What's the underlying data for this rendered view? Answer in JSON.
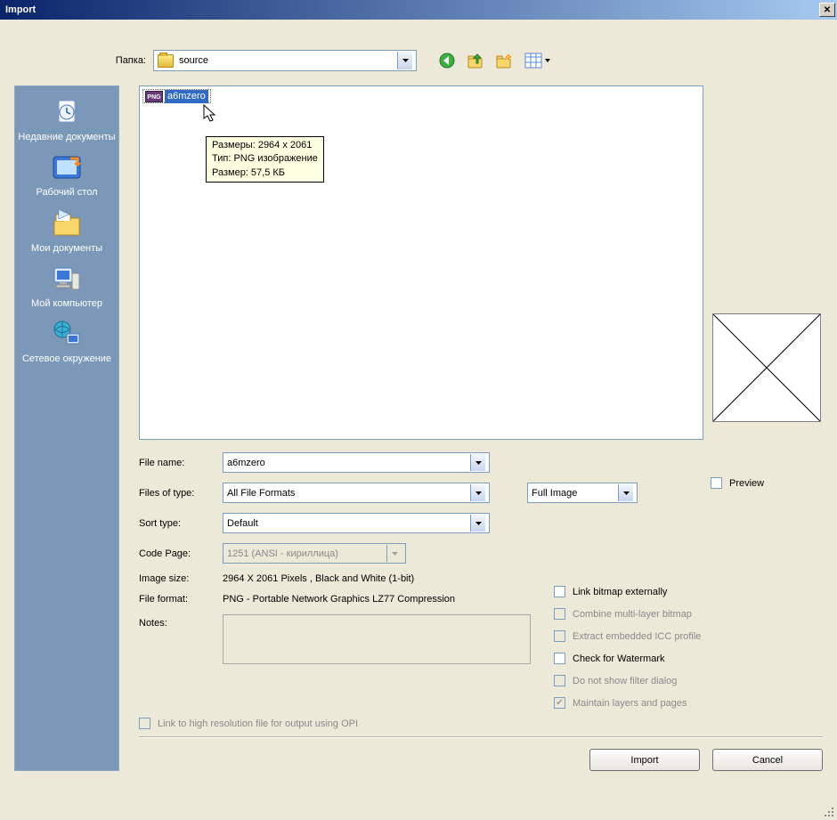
{
  "window": {
    "title": "Import"
  },
  "lookin": {
    "label": "Папка:",
    "value": "source"
  },
  "toolbar_icons": [
    "back-icon",
    "up-icon",
    "new-folder-icon",
    "views-icon"
  ],
  "sidebar": {
    "items": [
      {
        "label": "Недавние документы"
      },
      {
        "label": "Рабочий стол"
      },
      {
        "label": "Мои документы"
      },
      {
        "label": "Мой компьютер"
      },
      {
        "label": "Сетевое окружение"
      }
    ]
  },
  "file": {
    "name": "a6mzero",
    "badge": "PNG",
    "tooltip": {
      "line1": "Размеры: 2964 x 2061",
      "line2": "Тип: PNG изображение",
      "line3": "Размер: 57,5 КБ"
    }
  },
  "form": {
    "filename_label": "File name:",
    "filename_value": "a6mzero",
    "filetype_label": "Files of type:",
    "filetype_value": "All File Formats",
    "sort_label": "Sort type:",
    "sort_value": "Default",
    "codepage_label": "Code Page:",
    "codepage_value": "1251  (ANSI - кириллица)",
    "imagesize_label": "Image size:",
    "imagesize_value": "2964 X 2061 Pixels , Black and White (1-bit)",
    "fileformat_label": "File format:",
    "fileformat_value": "PNG - Portable Network Graphics LZ77 Compression",
    "notes_label": "Notes:",
    "fullimage": "Full Image",
    "preview": "Preview"
  },
  "options": {
    "link_bitmap": "Link bitmap externally",
    "combine": "Combine multi-layer bitmap",
    "extract_icc": "Extract embedded ICC profile",
    "watermark": "Check for Watermark",
    "filter_dialog": "Do not show filter dialog",
    "layers": "Maintain layers and pages",
    "opi": "Link to high resolution file for output using OPI"
  },
  "buttons": {
    "import": "Import",
    "cancel": "Cancel"
  }
}
